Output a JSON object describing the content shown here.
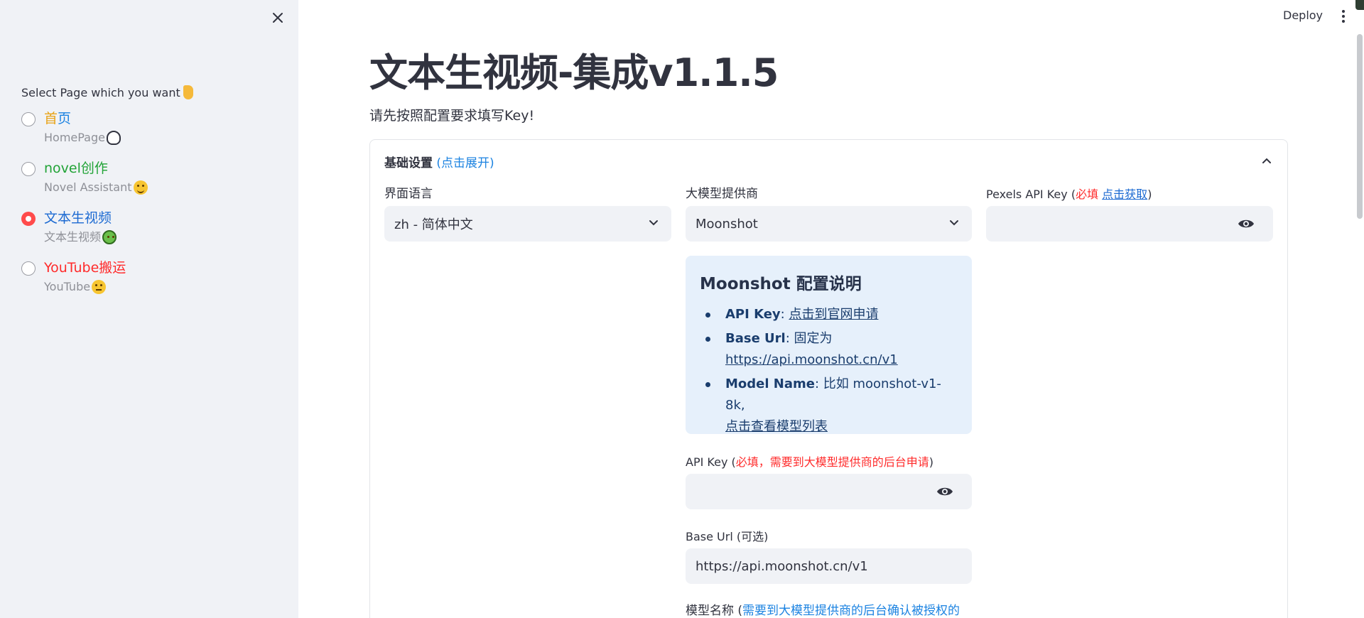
{
  "sidebar": {
    "select_label": "Select Page which you want",
    "items": [
      {
        "title": "首页",
        "subtitle": "HomePage",
        "color": "#e8a317",
        "title_color2": "#1c83e1"
      },
      {
        "title": "novel创作",
        "subtitle": "Novel Assistant",
        "color": "#21a336"
      },
      {
        "title": "文本生视频",
        "subtitle": "文本生视频",
        "color": "#1c6ad2"
      },
      {
        "title": "YouTube搬运",
        "subtitle": "YouTube",
        "color": "#ff2b2b"
      }
    ],
    "selected_index": 2
  },
  "header": {
    "deploy_label": "Deploy"
  },
  "main": {
    "title": "文本生视频-集成v1.1.5",
    "subtitle": "请先按照配置要求填写Key!",
    "expander": {
      "title": "基础设置",
      "hint": "(点击展开)"
    },
    "language": {
      "label": "界面语言",
      "value": "zh - 简体中文"
    },
    "provider": {
      "label": "大模型提供商",
      "value": "Moonshot"
    },
    "pexels": {
      "label_prefix": "Pexels API Key (",
      "required": "必填",
      "link": "点击获取",
      "label_suffix": ")",
      "value": ""
    },
    "info": {
      "title": "Moonshot 配置说明",
      "api_key_label": "API Key",
      "api_key_link": "点击到官网申请",
      "base_url_label": "Base Url",
      "base_url_text": ": 固定为",
      "base_url_link": "https://api.moonshot.cn/v1",
      "model_name_label": "Model Name",
      "model_name_text": ": 比如 moonshot-v1-8k,",
      "model_name_link": "点击查看模型列表"
    },
    "api_key": {
      "label_prefix": "API Key (",
      "required": "必填，需要到大模型提供商的后台申请",
      "label_suffix": ")",
      "value": ""
    },
    "base_url": {
      "label": "Base Url (可选)",
      "value": "https://api.moonshot.cn/v1"
    },
    "model_name": {
      "label_prefix": "模型名称 (",
      "hint": "需要到大模型提供商的后台确认被授权的"
    }
  }
}
